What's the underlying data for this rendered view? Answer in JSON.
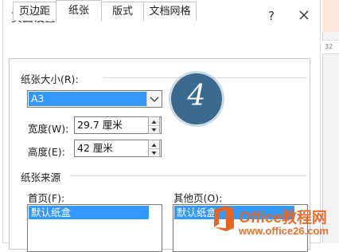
{
  "background": {
    "ruler_text": "32"
  },
  "dialog": {
    "title": "页面设置",
    "help_label": "?",
    "tabs": [
      {
        "label": "页边距"
      },
      {
        "label": "纸张"
      },
      {
        "label": "版式"
      },
      {
        "label": "文档网格"
      }
    ],
    "active_tab": "纸张",
    "paper_size": {
      "group_label": "纸张大小(R):",
      "selected": "A3",
      "width_label": "宽度(W):",
      "width_value": "29.7 厘米",
      "height_label": "高度(E):",
      "height_value": "42 厘米"
    },
    "paper_source": {
      "group_label": "纸张来源",
      "first_page_label": "首页(F):",
      "first_page_selected": "默认纸盒",
      "other_pages_label": "其他页(O):",
      "other_pages_selected": "默认纸盒"
    }
  },
  "annotation": {
    "step_number": "4",
    "color": "#3a6b8e"
  },
  "watermark": {
    "line1": "Office教程网",
    "line2": "www.office26.com",
    "color": "#e7661f"
  },
  "colors": {
    "selection": "#3399ff",
    "border": "#7a7a7a"
  }
}
